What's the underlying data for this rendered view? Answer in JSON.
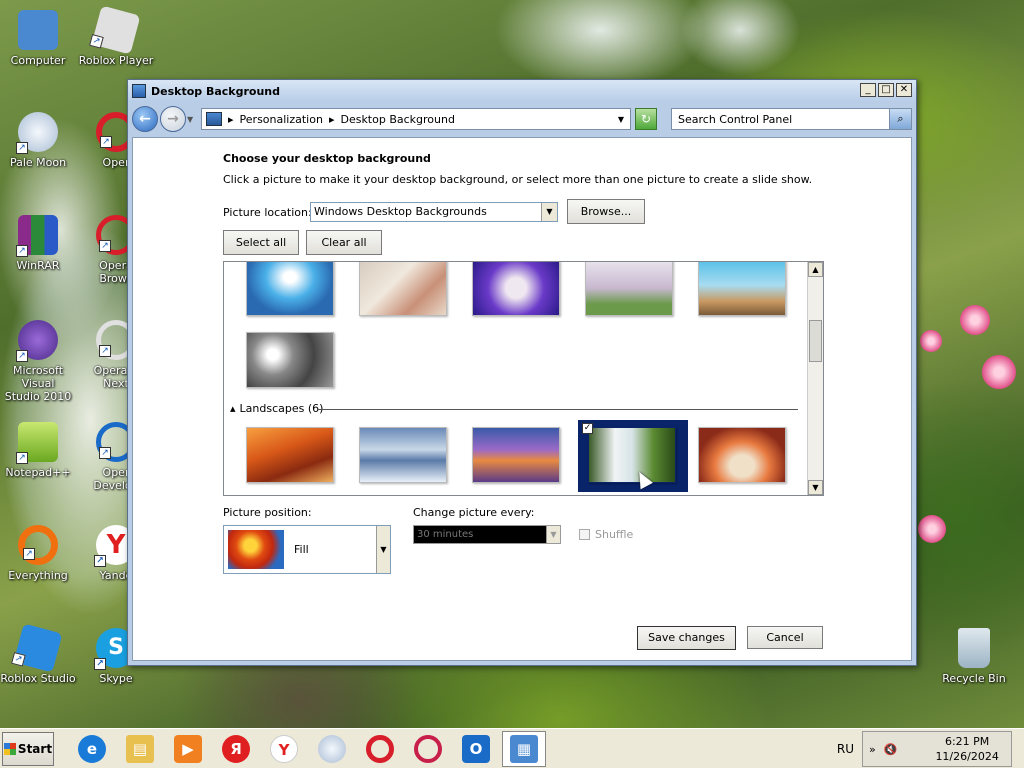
{
  "desktop": {
    "icons": [
      {
        "label": "Computer",
        "color": "#4a88d0",
        "glyph": "▭"
      },
      {
        "label": "Roblox Player",
        "color": "#d8d8d8",
        "glyph": "◆"
      },
      {
        "label": "Pale Moon",
        "color": "#c8d4e4",
        "glyph": "●"
      },
      {
        "label": "Oper",
        "color": "#d81e2a",
        "glyph": "O"
      },
      {
        "label": "WinRAR",
        "color": "#8a2a8a",
        "glyph": "▦"
      },
      {
        "label": "Opera\nBrows",
        "color": "#d81e2a",
        "glyph": "O"
      },
      {
        "label": "Microsoft Visual\nStudio 2010",
        "color": "#6a3aa8",
        "glyph": "∞"
      },
      {
        "label": "Opera B\nNext",
        "color": "#e0e0e0",
        "glyph": "O"
      },
      {
        "label": "Notepad++",
        "color": "#7ab830",
        "glyph": "✎"
      },
      {
        "label": "Oper\nDevelop",
        "color": "#1a6ac8",
        "glyph": "O"
      },
      {
        "label": "Everything",
        "color": "#f07010",
        "glyph": "◯"
      },
      {
        "label": "Yande",
        "color": "#ffffff",
        "glyph": "Y"
      },
      {
        "label": "Roblox Studio",
        "color": "#2a8ae0",
        "glyph": "◆"
      },
      {
        "label": "Skype",
        "color": "#1aa0e0",
        "glyph": "S"
      },
      {
        "label": "Recycle Bin",
        "color": "#b0c8d8",
        "glyph": "🗑"
      }
    ]
  },
  "window": {
    "title": "Desktop Background",
    "controls": {
      "min": "_",
      "max": "□",
      "close": "✕"
    },
    "breadcrumb": [
      "Personalization",
      "Desktop Background"
    ],
    "search_placeholder": "Search Control Panel",
    "heading": "Choose your desktop background",
    "description": "Click a picture to make it your desktop background, or select more than one picture to create a slide show.",
    "picture_location_label": "Picture location:",
    "picture_location_value": "Windows Desktop Backgrounds",
    "browse_label": "Browse...",
    "select_all_label": "Select all",
    "clear_all_label": "Clear all",
    "group_landscapes": "Landscapes (6)",
    "position_label": "Picture position:",
    "position_value": "Fill",
    "change_label": "Change picture every:",
    "change_value": "30 minutes",
    "shuffle_label": "Shuffle",
    "save_label": "Save changes",
    "cancel_label": "Cancel"
  },
  "taskbar": {
    "start_label": "Start",
    "apps": [
      {
        "name": "internet-explorer",
        "glyph": "e",
        "color": "#1a7ad8",
        "active": false
      },
      {
        "name": "file-explorer",
        "glyph": "▤",
        "color": "#e8c050",
        "active": false
      },
      {
        "name": "media-player",
        "glyph": "▶",
        "color": "#f08020",
        "active": false
      },
      {
        "name": "yandex-browser",
        "glyph": "Я",
        "color": "#e02020",
        "active": false
      },
      {
        "name": "yandex",
        "glyph": "Y",
        "color": "#e02020",
        "active": false
      },
      {
        "name": "pale-moon",
        "glyph": "●",
        "color": "#b8c8dc",
        "active": false
      },
      {
        "name": "opera",
        "glyph": "O",
        "color": "#d81e2a",
        "active": false
      },
      {
        "name": "opera-beta",
        "glyph": "O",
        "color": "#c81e4a",
        "active": false
      },
      {
        "name": "opera-developer",
        "glyph": "O",
        "color": "#1a6ac8",
        "active": false
      },
      {
        "name": "control-panel",
        "glyph": "▦",
        "color": "#4a88d0",
        "active": true
      }
    ],
    "language": "RU",
    "time": "6:21 PM",
    "date": "11/26/2024"
  }
}
